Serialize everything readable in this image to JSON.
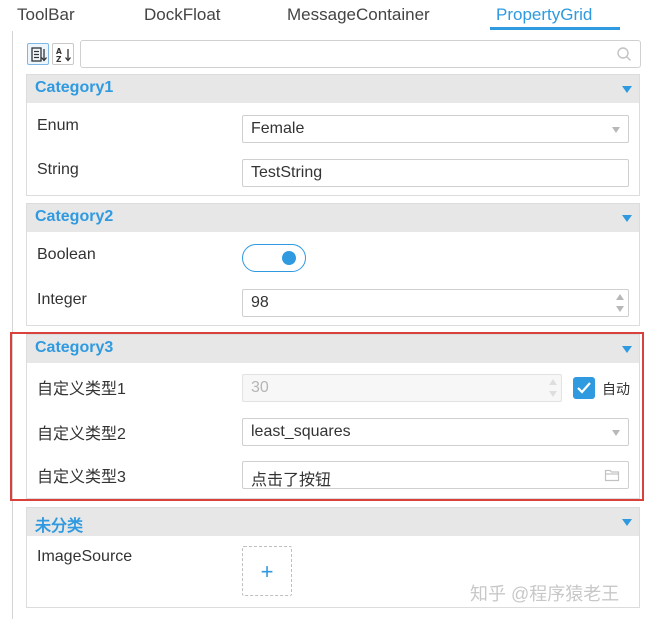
{
  "tabs": [
    {
      "label": "ToolBar"
    },
    {
      "label": "DockFloat"
    },
    {
      "label": "MessageContainer"
    },
    {
      "label": "PropertyGrid"
    }
  ],
  "active_tab": "PropertyGrid",
  "toolbar": {
    "sort_category_icon": "categorized-sort-icon",
    "sort_alpha_icon": "alphabetical-sort-icon",
    "search_placeholder": "",
    "search_icon": "search-icon"
  },
  "categories": [
    {
      "title": "Category1",
      "rows": [
        {
          "label": "Enum",
          "value": "Female",
          "editor": "dropdown"
        },
        {
          "label": "String",
          "value": "TestString",
          "editor": "textbox"
        }
      ]
    },
    {
      "title": "Category2",
      "rows": [
        {
          "label": "Boolean",
          "value": true,
          "editor": "toggle"
        },
        {
          "label": "Integer",
          "value": "98",
          "editor": "numeric"
        }
      ]
    },
    {
      "title": "Category3",
      "rows": [
        {
          "label": "自定义类型1",
          "value": "30",
          "editor": "numeric-disabled",
          "checkbox_label": "自动",
          "checkbox_checked": true
        },
        {
          "label": "自定义类型2",
          "value": "least_squares",
          "editor": "dropdown"
        },
        {
          "label": "自定义类型3",
          "value": "点击了按钮",
          "editor": "file-picker"
        }
      ]
    },
    {
      "title": "未分类",
      "rows": [
        {
          "label": "ImageSource",
          "value": "+",
          "editor": "image-add"
        }
      ]
    }
  ],
  "watermark": "知乎 @程序猿老王",
  "colors": {
    "accent": "#2f9ae0",
    "highlight_frame": "#d9413d",
    "category_header_bg": "#e7e7e7"
  }
}
